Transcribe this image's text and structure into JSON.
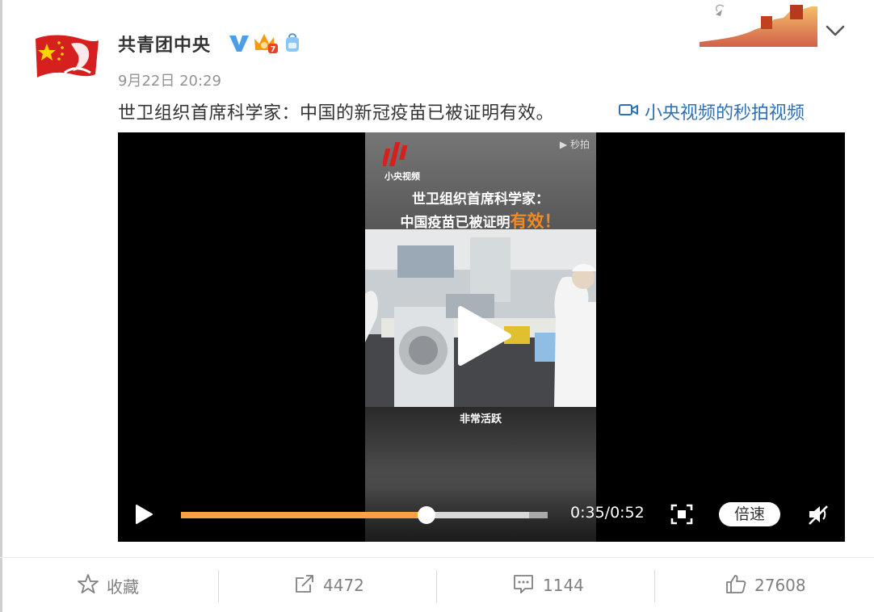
{
  "post": {
    "username": "共青团中央",
    "timestamp": "9月22日 20:29",
    "text": "世卫组织首席科学家：中国的新冠疫苗已被证明有效。",
    "video_link_label": "小央视频的秒拍视频"
  },
  "badges": [
    "verified-v-icon",
    "crown-member-icon",
    "backpack-icon"
  ],
  "video": {
    "watermark": "秒拍",
    "logo_text": "小央视频",
    "headline_line1": "世卫组织首席科学家：",
    "headline_line2_main": "中国疫苗已被证明",
    "headline_line2_highlight": "有效！",
    "subtitle": "非常活跃",
    "current_time": "0:35",
    "duration": "0:52",
    "time_display": "0:35/0:52",
    "progress_fraction": 0.67,
    "buffered_fraction": 0.95,
    "speed_label": "倍速"
  },
  "actions": {
    "favorite_label": "收藏",
    "repost_count": "4472",
    "comment_count": "1144",
    "like_count": "27608"
  },
  "colors": {
    "link": "#2f70b5",
    "progress": "#f4a340",
    "highlight": "#f08a24",
    "muted_text": "#808080"
  }
}
